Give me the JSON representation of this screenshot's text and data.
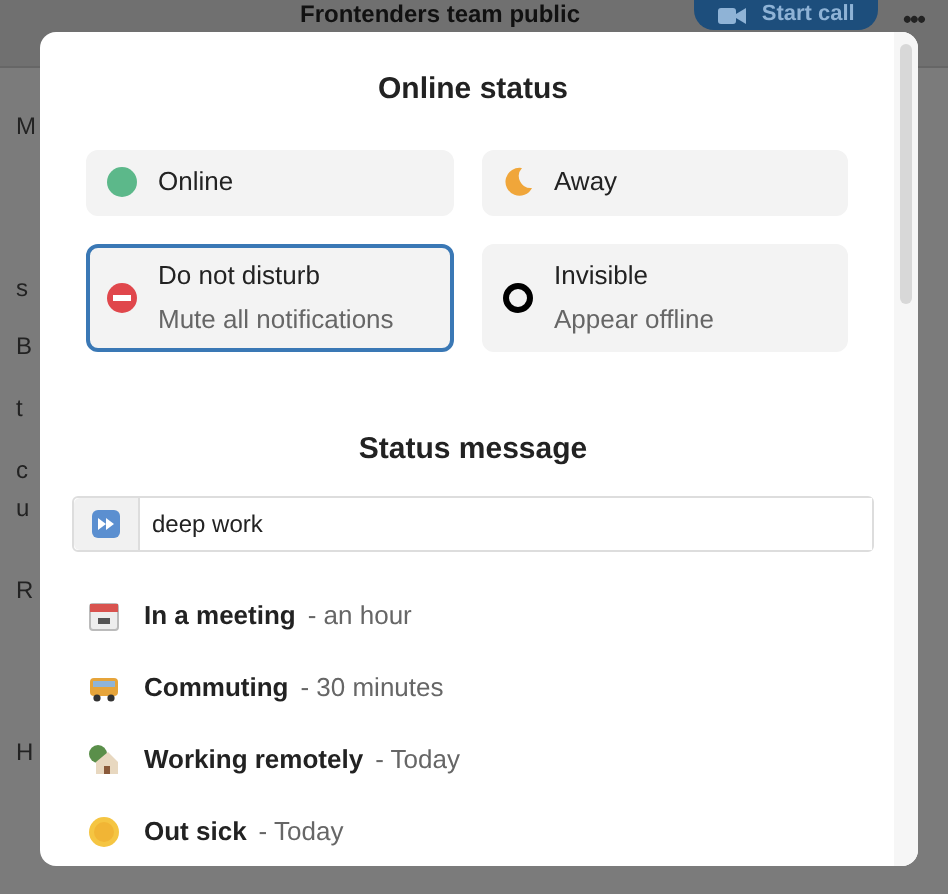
{
  "header": {
    "title": "Frontenders team public",
    "call_button": "Start call",
    "more": "•••"
  },
  "background_fragments": [
    "M",
    "s",
    "B",
    "t",
    "c",
    "u",
    "R",
    "H"
  ],
  "dialog": {
    "title": "Online status",
    "statuses": [
      {
        "label": "Online",
        "kind": "online",
        "selected": false
      },
      {
        "label": "Away",
        "kind": "away",
        "selected": false
      },
      {
        "label": "Do not disturb",
        "description": "Mute all notifications",
        "kind": "dnd",
        "selected": true
      },
      {
        "label": "Invisible",
        "description": "Appear offline",
        "kind": "invisible",
        "selected": false
      }
    ],
    "message_title": "Status message",
    "message": {
      "value": "deep work"
    },
    "presets": [
      {
        "label": "In a meeting",
        "duration": "- an hour",
        "kind": "calendar"
      },
      {
        "label": "Commuting",
        "duration": "- 30 minutes",
        "kind": "bus"
      },
      {
        "label": "Working remotely",
        "duration": "- Today",
        "kind": "house"
      },
      {
        "label": "Out sick",
        "duration": "- Today",
        "kind": "sick"
      }
    ]
  }
}
